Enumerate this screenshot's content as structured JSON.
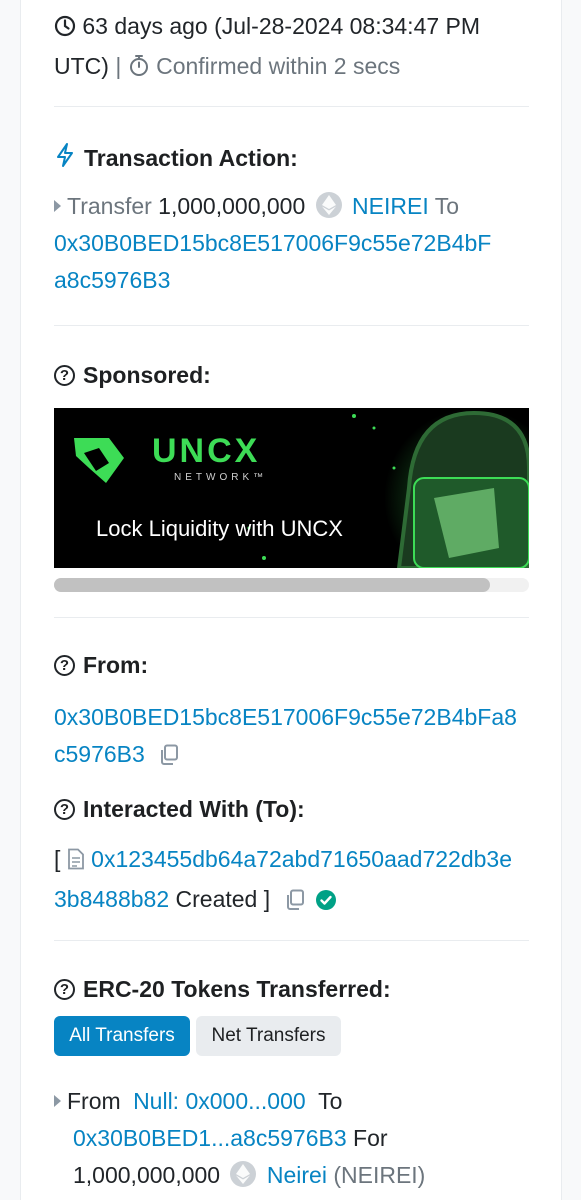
{
  "timestamp": {
    "age": "63 days ago (Jul-28-2024 08:34:47 PM",
    "utc": "UTC)",
    "separator": "|",
    "confirmed": "Confirmed within 2 secs"
  },
  "transaction_action": {
    "label": "Transaction Action:",
    "verb": "Transfer",
    "amount": "1,000,000,000",
    "token": "NEIREI",
    "to_word": "To",
    "to_address_line1": "0x30B0BED15bc8E517006F9c55e72B4bF",
    "to_address_line2": "a8c5976B3"
  },
  "sponsored": {
    "label": "Sponsored:",
    "ad_brand": "UNCX",
    "ad_sub": "NETWORK™",
    "ad_tagline": "Lock Liquidity with UNCX"
  },
  "from": {
    "label": "From:",
    "address_line1": "0x30B0BED15bc8E517006F9c55e72B4bFa8",
    "address_line2": "c5976B3"
  },
  "interacted": {
    "label": "Interacted With (To):",
    "open_bracket": "[",
    "address_line1": "0x123455db64a72abd71650aad722db3e",
    "address_line2": "3b8488b82",
    "created": "Created ]"
  },
  "erc20": {
    "label": "ERC-20 Tokens Transferred:",
    "tab_all": "All Transfers",
    "tab_net": "Net Transfers",
    "from_word": "From",
    "from_address": "Null: 0x000...000",
    "to_word": "To",
    "to_address": "0x30B0BED1...a8c5976B3",
    "for_word": "For",
    "amount": "1,000,000,000",
    "token_name": "Neirei",
    "token_symbol": "(NEIREI)"
  },
  "colors": {
    "link": "#0784c3",
    "success": "#00a186",
    "ad_green": "#3ddc56"
  }
}
